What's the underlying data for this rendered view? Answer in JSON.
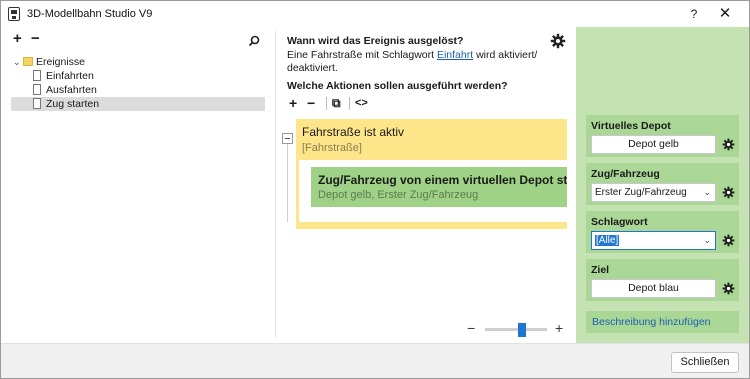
{
  "window": {
    "title": "3D-Modellbahn Studio V9",
    "help_label": "?",
    "close_glyph": "✕"
  },
  "left": {
    "tools": {
      "add": "+",
      "remove": "−",
      "search": "⚲"
    },
    "tree": {
      "root": {
        "label": "Ereignisse",
        "chevron": "⌄"
      },
      "items": [
        {
          "label": "Einfahrten"
        },
        {
          "label": "Ausfahrten"
        },
        {
          "label": "Zug starten"
        }
      ]
    }
  },
  "middle": {
    "trigger_heading": "Wann wird das Ereignis ausgelöst?",
    "trigger_text_before": "Eine Fahrstraße mit Schlagwort ",
    "trigger_link": "Einfahrt",
    "trigger_text_after": " wird aktiviert/ deaktiviert.",
    "actions_heading": "Welche Aktionen sollen ausgeführt werden?",
    "tools": {
      "add": "+",
      "remove": "−",
      "copy": "⧉",
      "code": "<>"
    },
    "blocks": {
      "condition": {
        "title": "Fahrstraße ist aktiv",
        "subtitle": "[Fahrstraße]"
      },
      "action": {
        "title": "Zug/Fahrzeug von einem virtuellen Depot starten",
        "subtitle": "Depot gelb, Erster Zug/Fahrzeug"
      }
    },
    "zoom": {
      "minus": "−",
      "plus": "+",
      "level": 0.6
    }
  },
  "right": {
    "props": [
      {
        "label": "Virtuelles Depot",
        "kind": "button",
        "value": "Depot gelb"
      },
      {
        "label": "Zug/Fahrzeug",
        "kind": "select",
        "value": "Erster Zug/Fahrzeug"
      },
      {
        "label": "Schlagwort",
        "kind": "select",
        "value": "[Alle]"
      },
      {
        "label": "Ziel",
        "kind": "button",
        "value": "Depot blau"
      }
    ],
    "description_link": "Beschreibung hinzufügen"
  },
  "footer": {
    "close_label": "Schließen"
  },
  "colors": {
    "condition_block": "#fde58a",
    "action_block": "#9fd186",
    "right_panel": "#c5e3b2",
    "property_card": "#aad796",
    "accent": "#1e76d1"
  }
}
